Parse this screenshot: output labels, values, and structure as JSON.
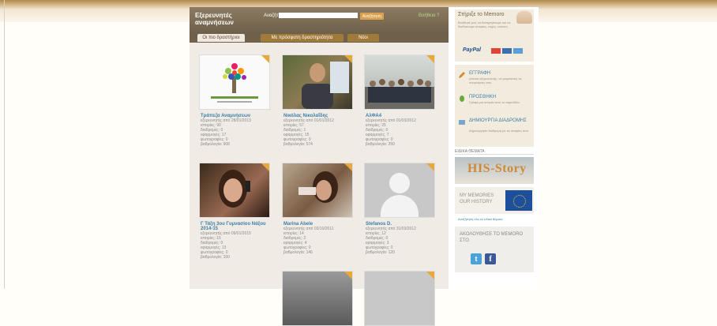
{
  "header": {
    "logo_text": "Εξερευνητές αναμνήσεων",
    "search_label": "Αναζήτηση",
    "search_value": "",
    "search_button": "Αναζήτηση",
    "help_link": "Βοήθεια ?"
  },
  "tabs": [
    {
      "label": "Οι πιο δραστήριοι",
      "active": true
    },
    {
      "label": "Με πρόσφατη δραστηριότητα",
      "active": false
    },
    {
      "label": "Νέοι",
      "active": false
    }
  ],
  "users": [
    {
      "name": "Τράπεζα Αναμνήσεων",
      "since": "εξερευνητής από 28/01/2013",
      "stories": "ιστορίες: 90",
      "comments": "διαδρομές: 0",
      "followers": "εφαρμογές: 17",
      "photos": "φωτογραφίες: 0",
      "score": "βαθμολογία: 908",
      "photo": "tree"
    },
    {
      "name": "Νικόλας Νικολαΐδης",
      "since": "εξερευνητής από 01/01/2012",
      "stories": "ιστορίες: 57",
      "comments": "διαδρομές: 1",
      "followers": "εφαρμογές: 15",
      "photos": "φωτογραφίες: 0",
      "score": "βαθμολογία: 574",
      "photo": "man"
    },
    {
      "name": "ΑλΦΑ4",
      "since": "εξερευνητής από 01/03/2012",
      "stories": "ιστορίες: 25",
      "comments": "διαδρομές: 0",
      "followers": "εφαρμογές: 7",
      "photos": "φωτογραφίες: 0",
      "score": "βαθμολογία: 250",
      "photo": "group"
    },
    {
      "name": "Γ Τάξη 3ου Γυμνασίου Νάξου 2014-15",
      "since": "εξερευνητής από 09/01/2015",
      "stories": "ιστορίες: 15",
      "comments": "διαδρομές: 0",
      "followers": "εφαρμογές: 13",
      "photos": "φωτογραφίες: 0",
      "score": "βαθμολογία: 150",
      "photo": "woman"
    },
    {
      "name": "Marina Abele",
      "since": "εξερευνητής από 03/10/2011",
      "stories": "ιστορίες: 14",
      "comments": "διαδρομές: 2",
      "followers": "εφαρμογές: 4",
      "photos": "φωτογραφίες: 0",
      "score": "βαθμολογία: 146",
      "photo": "woman2"
    },
    {
      "name": "Stefanos D.",
      "since": "εξερευνητής από 31/03/2012",
      "stories": "ιστορίες: 12",
      "comments": "διαδρομές: 0",
      "followers": "εφαρμογές: 3",
      "photos": "φωτογραφίες: 0",
      "score": "βαθμολογία: 120",
      "photo": "placeholder"
    }
  ],
  "sidebar": {
    "donate_title": "Στήριξε το Memoro",
    "donate_text": "Βοήθησέ μας να διατηρήσουμε και να διαδόσουμε ιστορίες, ευχές, εικόνες.",
    "paypal": "PayPal",
    "register": [
      {
        "title": "ΕΓΓΡΑΦΗ",
        "text": "γίνεσαι εξερευνητής, να μοιραστείς τις αναμνήσεις σου."
      },
      {
        "title": "ΠΡΟΣΘΗΚΗ",
        "text": "Γράψε μια ιστορία από το παρελθόν."
      },
      {
        "title": "ΔΗΜΙΟΥΡΓΙΑ ΔΙΑΔΡΟΜΗΣ",
        "text": "Δημιούργησε διαδρομή με τις ιστορίες σου."
      }
    ],
    "topics_label": "ΕΙΔΙΚΑ ΘΕΜΑΤΑ",
    "his_story": "HIS-Story",
    "my_memories_line1": "MY MEMORIES",
    "my_memories_line2": "OUR HISTORY",
    "learn_link": "Αναζήτηση όλα τα ειδικά θέματα",
    "follow_text": "ΑΚΟΛΟΥΘΗΣΕ ΤΟ MEMORO ΣΤΟ",
    "twitter": "t",
    "facebook": "f"
  }
}
